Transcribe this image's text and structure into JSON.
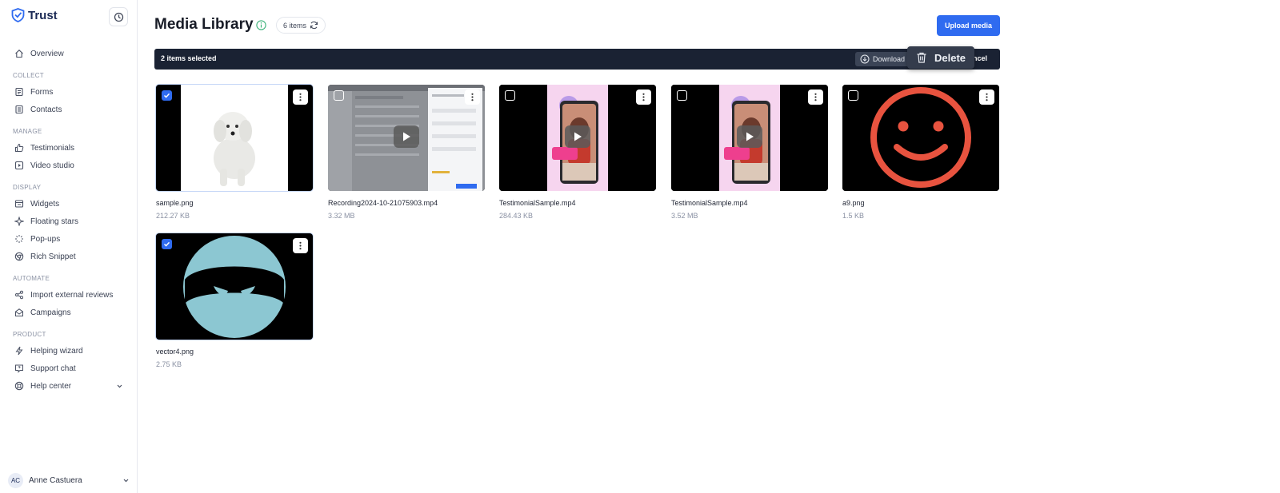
{
  "brand": {
    "name": "Trust",
    "color": "#2f6bf0"
  },
  "sidebar": {
    "sections": [
      {
        "title": "",
        "items": [
          {
            "label": "Overview",
            "icon": "home-icon"
          }
        ]
      },
      {
        "title": "COLLECT",
        "items": [
          {
            "label": "Forms",
            "icon": "form-icon"
          },
          {
            "label": "Contacts",
            "icon": "contacts-icon"
          }
        ]
      },
      {
        "title": "MANAGE",
        "items": [
          {
            "label": "Testimonials",
            "icon": "thumbs-up-icon"
          },
          {
            "label": "Video studio",
            "icon": "video-icon"
          }
        ]
      },
      {
        "title": "DISPLAY",
        "items": [
          {
            "label": "Widgets",
            "icon": "widget-icon"
          },
          {
            "label": "Floating stars",
            "icon": "sparkle-icon"
          },
          {
            "label": "Pop-ups",
            "icon": "loader-icon"
          },
          {
            "label": "Rich Snippet",
            "icon": "chrome-icon"
          }
        ]
      },
      {
        "title": "AUTOMATE",
        "items": [
          {
            "label": "Import external reviews",
            "icon": "share-icon"
          },
          {
            "label": "Campaigns",
            "icon": "mail-icon"
          }
        ]
      },
      {
        "title": "PRODUCT",
        "items": [
          {
            "label": "Helping wizard",
            "icon": "bolt-icon"
          },
          {
            "label": "Support chat",
            "icon": "chat-icon"
          },
          {
            "label": "Help center",
            "icon": "lifebuoy-icon",
            "expandable": true
          }
        ]
      }
    ],
    "user": {
      "initials": "AC",
      "name": "Anne Castuera"
    }
  },
  "header": {
    "title": "Media Library",
    "count_label": "6 items",
    "upload_label": "Upload media"
  },
  "selection": {
    "text": "2 items selected",
    "download_label": "Download",
    "delete_label": "Delete",
    "cancel_label": "ancel"
  },
  "media": [
    {
      "name": "sample.png",
      "size": "212.27 KB",
      "kind": "dog",
      "selected": true
    },
    {
      "name": "Recording2024-10-21075903.mp4",
      "size": "3.32 MB",
      "kind": "recording",
      "selected": false
    },
    {
      "name": "TestimonialSample.mp4",
      "size": "284.43 KB",
      "kind": "testimonial",
      "selected": false
    },
    {
      "name": "TestimonialSample.mp4",
      "size": "3.52 MB",
      "kind": "testimonial",
      "selected": false
    },
    {
      "name": "a9.png",
      "size": "1.5 KB",
      "kind": "smiley",
      "selected": false
    },
    {
      "name": "vector4.png",
      "size": "2.75 KB",
      "kind": "ninja",
      "selected": true
    }
  ],
  "colors": {
    "accent": "#2f6bf0",
    "selection_bar": "#1a2233",
    "smiley": "#e8533f",
    "ninja": "#8cc7d2",
    "testimonial_bg": "#f6d5ef"
  }
}
